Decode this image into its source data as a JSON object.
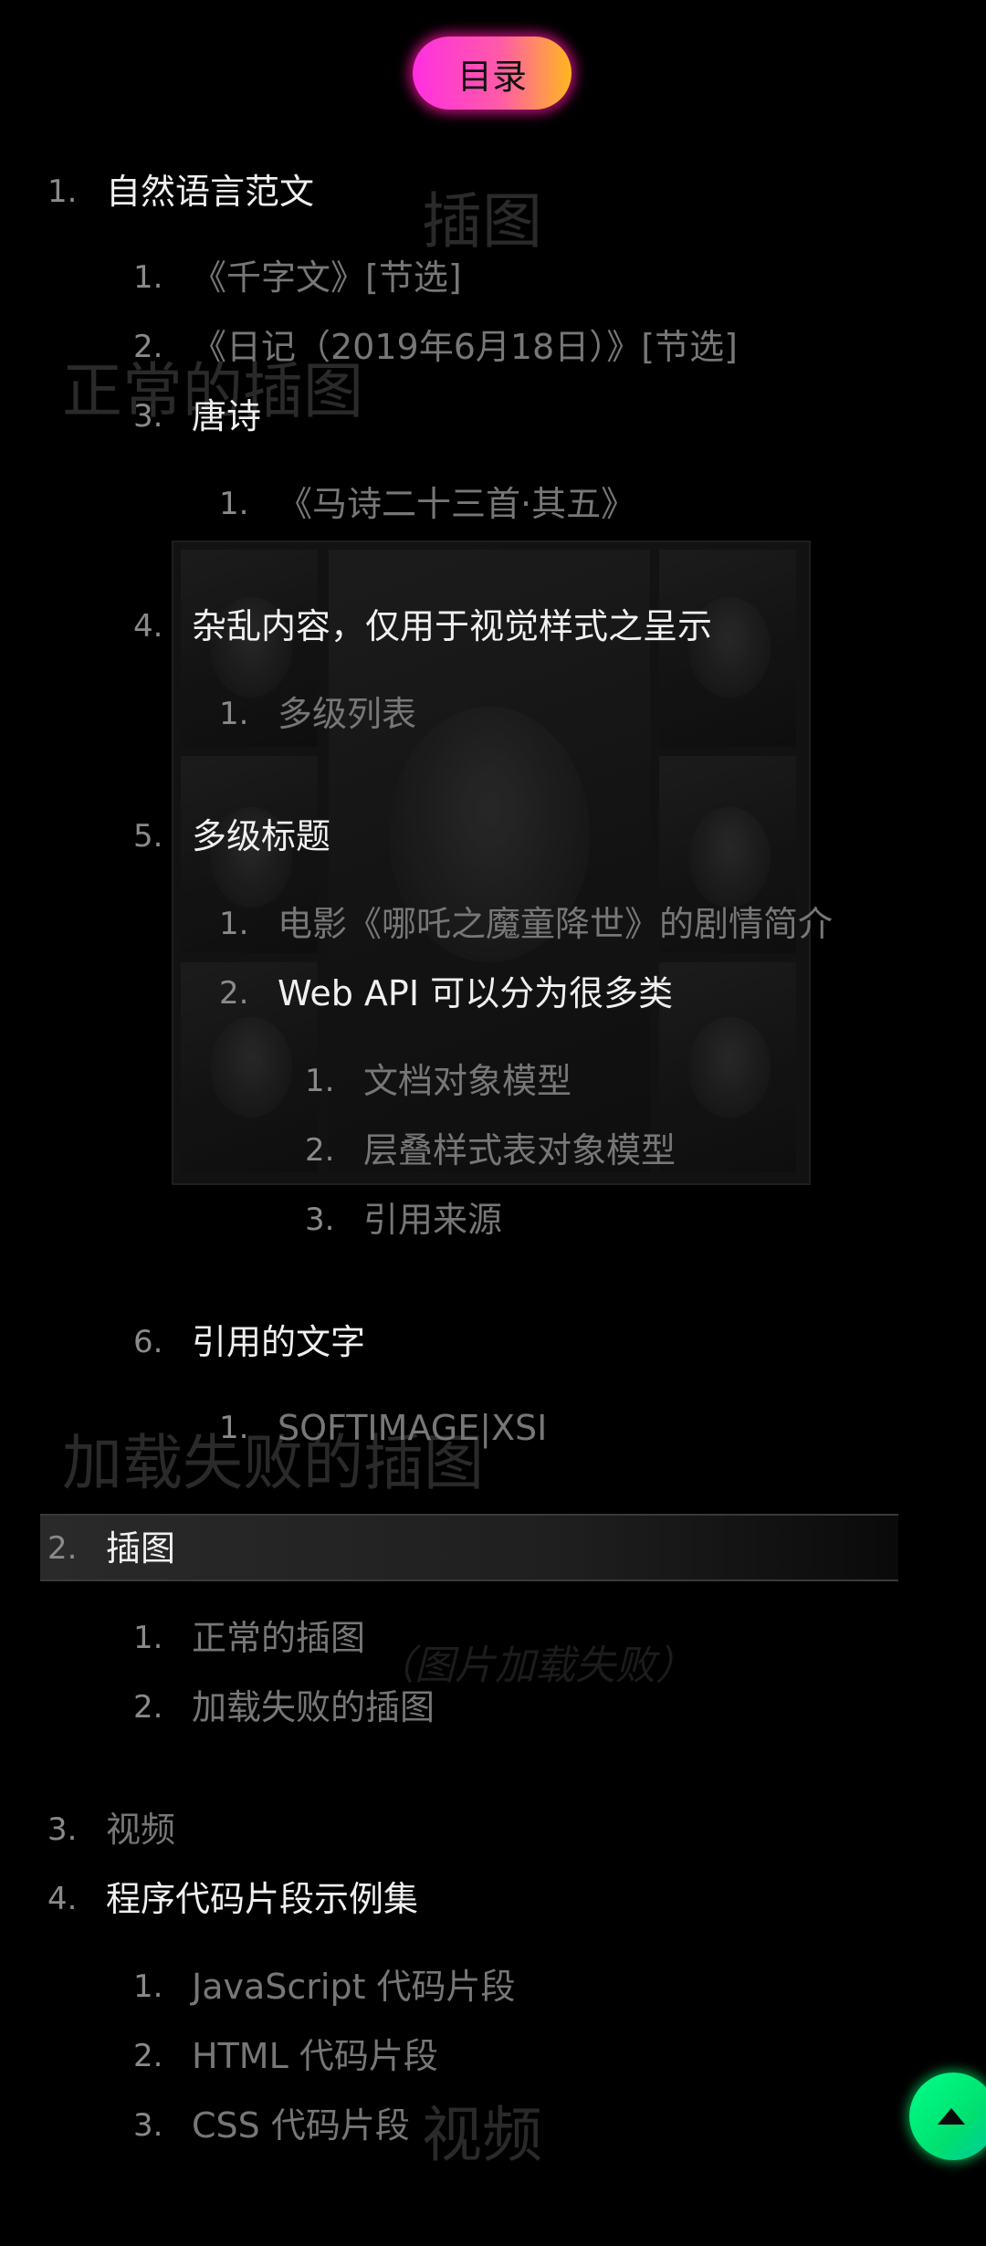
{
  "toc": {
    "title": "目录",
    "items": [
      {
        "num": "1.",
        "label": "自然语言范文"
      },
      {
        "num": "1.",
        "label": "《千字文》[节选]"
      },
      {
        "num": "2.",
        "label": "《日记（2019年6月18日）》[节选]"
      },
      {
        "num": "3.",
        "label": "唐诗"
      },
      {
        "num": "1.",
        "label": "《马诗二十三首·其五》"
      },
      {
        "num": "4.",
        "label": "杂乱内容，仅用于视觉样式之呈示"
      },
      {
        "num": "1.",
        "label": "多级列表"
      },
      {
        "num": "5.",
        "label": "多级标题"
      },
      {
        "num": "1.",
        "label": "电影《哪吒之魔童降世》的剧情简介"
      },
      {
        "num": "2.",
        "label": "Web API 可以分为很多类"
      },
      {
        "num": "1.",
        "label": "文档对象模型"
      },
      {
        "num": "2.",
        "label": "层叠样式表对象模型"
      },
      {
        "num": "3.",
        "label": "引用来源"
      },
      {
        "num": "6.",
        "label": "引用的文字"
      },
      {
        "num": "1.",
        "label": "SOFTIMAGE|XSI"
      },
      {
        "num": "2.",
        "label": "插图"
      },
      {
        "num": "1.",
        "label": "正常的插图"
      },
      {
        "num": "2.",
        "label": "加载失败的插图"
      },
      {
        "num": "3.",
        "label": "视频"
      },
      {
        "num": "4.",
        "label": "程序代码片段示例集"
      },
      {
        "num": "1.",
        "label": "JavaScript 代码片段"
      },
      {
        "num": "2.",
        "label": "HTML 代码片段"
      },
      {
        "num": "3.",
        "label": "CSS 代码片段"
      }
    ]
  },
  "background": {
    "heading_illustrations": "插图",
    "heading_normal": "正常的插图",
    "heading_failed": "加载失败的插图",
    "failed_caption": "（图片加载失败）",
    "heading_video": "视频"
  },
  "back_to_top": {
    "icon": "arrow-up-icon"
  },
  "colors": {
    "pill_start": "#ff2fe0",
    "pill_end": "#ffb820",
    "fab": "#00ff88"
  }
}
